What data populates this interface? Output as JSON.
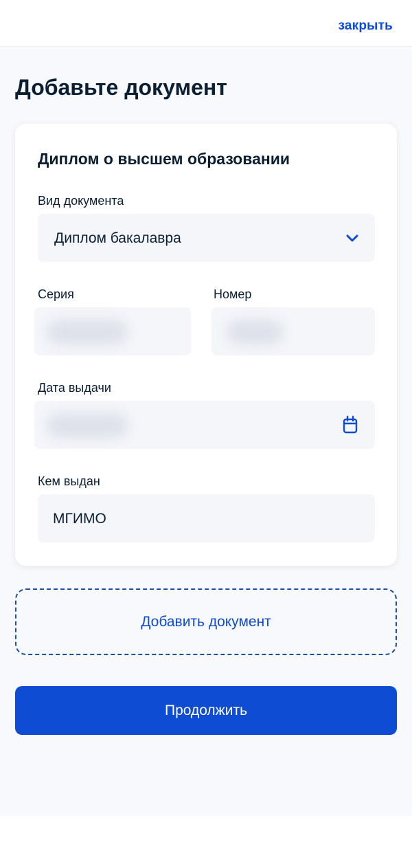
{
  "header": {
    "close_label": "закрыть"
  },
  "page": {
    "title": "Добавьте документ"
  },
  "card": {
    "title": "Диплом о высшем образовании",
    "doc_type": {
      "label": "Вид документа",
      "value": "Диплом бакалавра",
      "icon": "chevron-down-icon"
    },
    "series": {
      "label": "Серия"
    },
    "number": {
      "label": "Номер"
    },
    "issue_date": {
      "label": "Дата выдачи",
      "icon": "calendar-icon"
    },
    "issued_by": {
      "label": "Кем выдан",
      "value": "МГИМО"
    }
  },
  "actions": {
    "add_document_label": "Добавить документ",
    "continue_label": "Продолжить"
  },
  "colors": {
    "accent": "#0d4cd3",
    "background": "#f8f9fc",
    "field_background": "#f4f6fa",
    "text": "#0b1f33"
  }
}
